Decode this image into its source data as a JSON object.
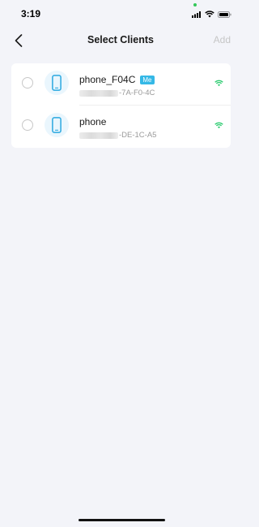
{
  "status_bar": {
    "time": "3:19",
    "icons": [
      "signal-icon",
      "wifi-icon",
      "battery-icon"
    ]
  },
  "nav": {
    "title": "Select Clients",
    "add_label": "Add",
    "back_icon": "chevron-left-icon"
  },
  "clients": [
    {
      "name": "phone_F04C",
      "badge": "Me",
      "mac_suffix": "-7A-F0-4C",
      "selected": false,
      "device_icon": "phone-icon",
      "signal_icon": "wifi-icon"
    },
    {
      "name": "phone",
      "badge": "",
      "mac_suffix": "-DE-1C-A5",
      "selected": false,
      "device_icon": "phone-icon",
      "signal_icon": "wifi-icon"
    }
  ],
  "colors": {
    "background": "#f3f4f9",
    "accent": "#35b8e6",
    "wifi": "#2ecc71",
    "add_disabled": "#c6c6c6"
  }
}
